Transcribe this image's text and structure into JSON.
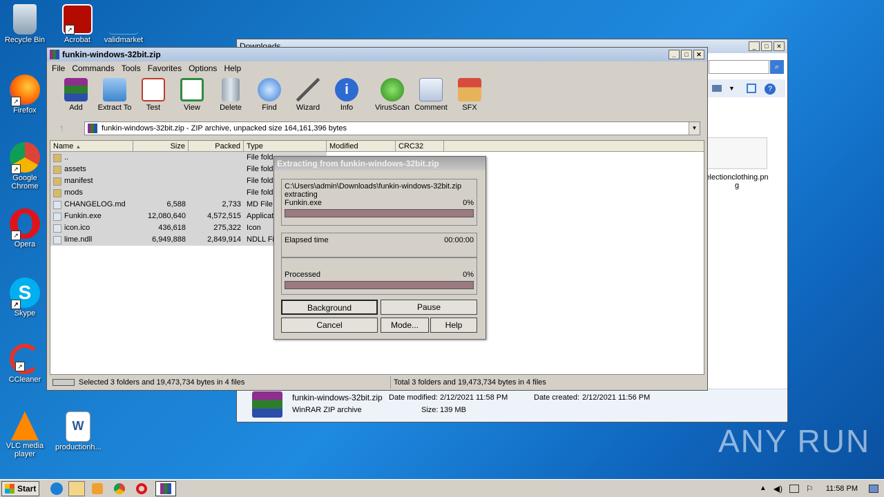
{
  "desktop": {
    "icons": [
      {
        "label": "Recycle Bin"
      },
      {
        "label": "Acrobat"
      },
      {
        "label": "validmarket"
      },
      {
        "label": "Firefox"
      },
      {
        "label": "Google Chrome"
      },
      {
        "label": "Opera"
      },
      {
        "label": "Skype"
      },
      {
        "label": "CCleaner"
      },
      {
        "label": "VLC media player"
      },
      {
        "label": "productionh..."
      }
    ],
    "watermark": "ANY RUN"
  },
  "explorer": {
    "title": "Downloads",
    "file_name": "funkin-windows-32bit.zip",
    "date_modified_label": "Date modified:",
    "date_modified": "2/12/2021 11:58 PM",
    "date_created_label": "Date created:",
    "date_created": "2/12/2021 11:56 PM",
    "file_type": "WinRAR ZIP archive",
    "size_label": "Size:",
    "size": "139 MB",
    "thumb_label": "electionclothing.pn g"
  },
  "winrar": {
    "title": "funkin-windows-32bit.zip",
    "menu": [
      "File",
      "Commands",
      "Tools",
      "Favorites",
      "Options",
      "Help"
    ],
    "toolbar": [
      "Add",
      "Extract To",
      "Test",
      "View",
      "Delete",
      "Find",
      "Wizard",
      "Info",
      "VirusScan",
      "Comment",
      "SFX"
    ],
    "address": "funkin-windows-32bit.zip - ZIP archive, unpacked size 164,161,396 bytes",
    "columns": [
      "Name",
      "Size",
      "Packed",
      "Type",
      "Modified",
      "CRC32"
    ],
    "rows": [
      {
        "name": "..",
        "size": "",
        "packed": "",
        "type": "File fold"
      },
      {
        "name": "assets",
        "size": "",
        "packed": "",
        "type": "File fold"
      },
      {
        "name": "manifest",
        "size": "",
        "packed": "",
        "type": "File fold"
      },
      {
        "name": "mods",
        "size": "",
        "packed": "",
        "type": "File fold"
      },
      {
        "name": "CHANGELOG.md",
        "size": "6,588",
        "packed": "2,733",
        "type": "MD File"
      },
      {
        "name": "Funkin.exe",
        "size": "12,080,640",
        "packed": "4,572,515",
        "type": "Applicat"
      },
      {
        "name": "icon.ico",
        "size": "436,618",
        "packed": "275,322",
        "type": "Icon"
      },
      {
        "name": "lime.ndll",
        "size": "6,949,888",
        "packed": "2,849,914",
        "type": "NDLL Fil"
      }
    ],
    "status_left": "Selected 3 folders and 19,473,734 bytes in 4 files",
    "status_right": "Total 3 folders and 19,473,734 bytes in 4 files"
  },
  "extract_dialog": {
    "title": "Extracting from funkin-windows-32bit.zip",
    "path": "C:\\Users\\admin\\Downloads\\funkin-windows-32bit.zip",
    "action": "extracting",
    "current_file": "Funkin.exe",
    "file_percent": "0%",
    "elapsed_label": "Elapsed time",
    "elapsed": "00:00:00",
    "processed_label": "Processed",
    "processed_percent": "0%",
    "buttons": {
      "background": "Background",
      "pause": "Pause",
      "cancel": "Cancel",
      "mode": "Mode...",
      "help": "Help"
    }
  },
  "taskbar": {
    "start": "Start",
    "clock": "11:58 PM"
  }
}
